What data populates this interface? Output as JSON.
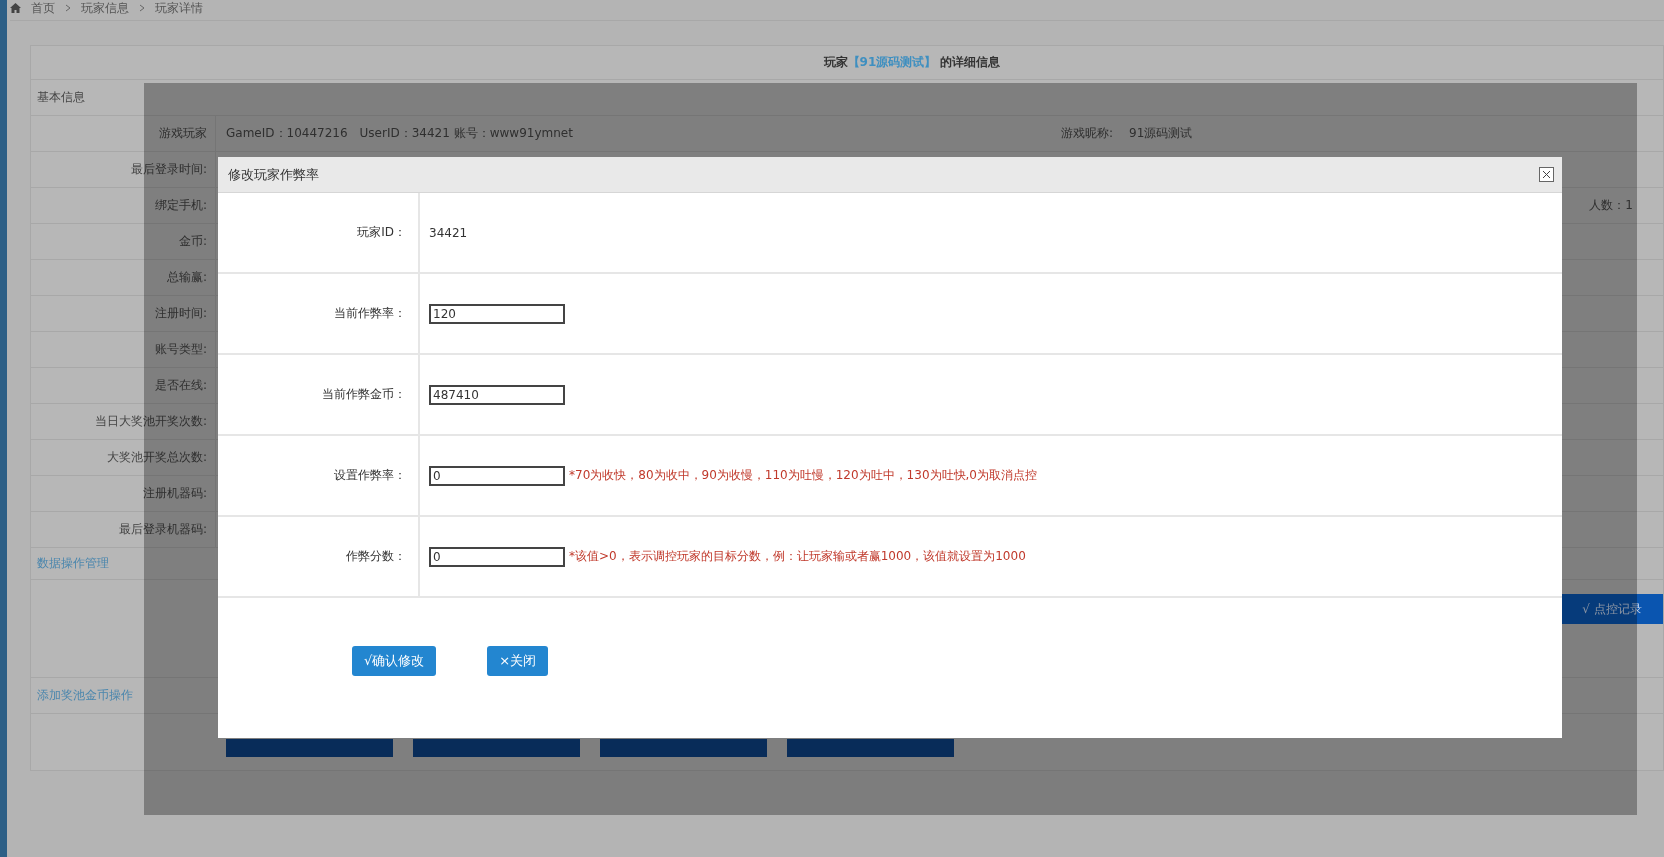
{
  "breadcrumb": [
    "首页",
    "玩家信息",
    "玩家详情"
  ],
  "panel_title": {
    "prefix": "玩家",
    "name": "【91源码测试】",
    "suffix": "的详细信息"
  },
  "section_basic": "基本信息",
  "info_rows": [
    {
      "label": "游戏玩家",
      "value": "GameID：10447216　UserID：34421 账号：www91ymnet",
      "label2": "游戏昵称:",
      "value2": "91源码测试"
    },
    {
      "label": "最后登录时间:"
    },
    {
      "label": "绑定手机:",
      "extra": "人数：1"
    },
    {
      "label": "金币:"
    },
    {
      "label": "总输赢:"
    },
    {
      "label": "注册时间:"
    },
    {
      "label": "账号类型:"
    },
    {
      "label": "是否在线:"
    },
    {
      "label": "当日大奖池开奖次数:"
    },
    {
      "label": "大奖池开奖总次数:"
    },
    {
      "label": "注册机器码:"
    },
    {
      "label": "最后登录机器码:"
    }
  ],
  "section_data": "数据操作管理",
  "record_button": "√ 点控记录",
  "section_pool": "添加奖池金币操作",
  "modal": {
    "title": "修改玩家作弊率",
    "rows": [
      {
        "label": "玩家ID：",
        "kind": "text",
        "value": "34421"
      },
      {
        "label": "当前作弊率：",
        "kind": "input",
        "value": "120"
      },
      {
        "label": "当前作弊金币：",
        "kind": "input",
        "value": "487410"
      },
      {
        "label": "设置作弊率：",
        "kind": "input",
        "value": "0",
        "hint": "*70为收快，80为收中，90为收慢，110为吐慢，120为吐中，130为吐快,0为取消点控"
      },
      {
        "label": "作弊分数：",
        "kind": "input",
        "value": "0",
        "hint": "*该值>0，表示调控玩家的目标分数，例：让玩家输或者赢1000，该值就设置为1000"
      }
    ],
    "buttons": [
      {
        "label": "√确认修改"
      },
      {
        "label": "×关闭"
      }
    ]
  }
}
